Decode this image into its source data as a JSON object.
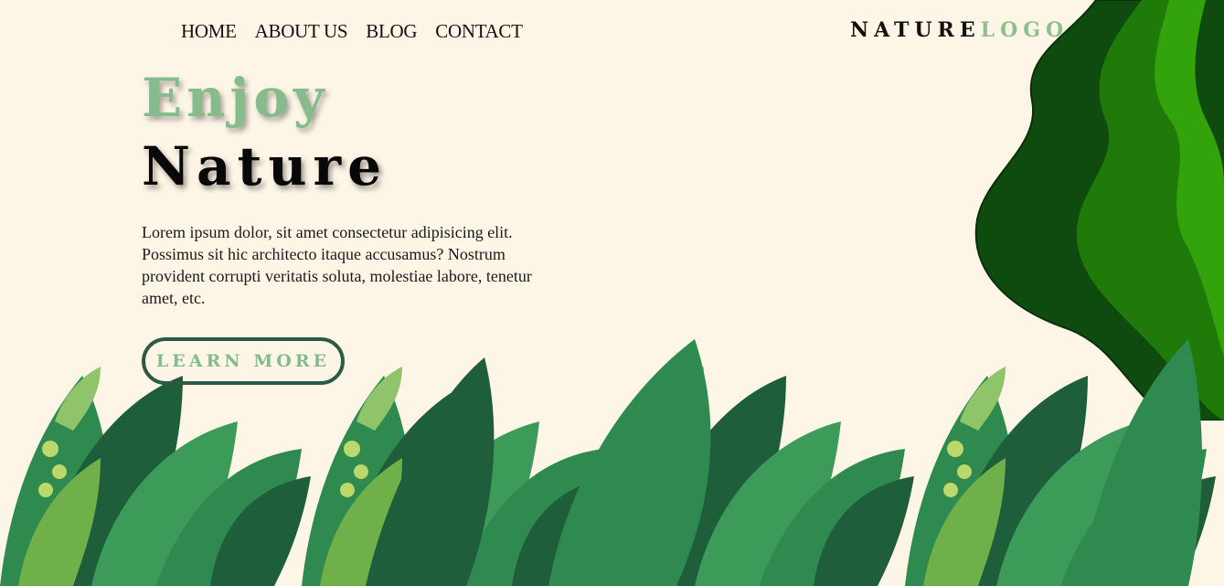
{
  "nav": {
    "items": [
      {
        "label": "HOME"
      },
      {
        "label": "ABOUT US"
      },
      {
        "label": "BLOG"
      },
      {
        "label": "CONTACT"
      }
    ]
  },
  "logo": {
    "part1": "NATURE",
    "part2": "LOGO"
  },
  "hero": {
    "line1": "Enjoy",
    "line2": "Nature",
    "description": "Lorem ipsum dolor, sit amet consectetur adipisicing elit. Possimus sit hic architecto itaque accusamus? Nostrum provident corrupti veritatis soluta, molestiae labore, tenetur amet, etc.",
    "button_label": "LEARN MORE"
  },
  "colors": {
    "background": "#fdf5e6",
    "accent_green": "#86bc8b",
    "dark_green": "#2d5a45",
    "leaf_dark": "#1f5e3a",
    "leaf_mid": "#2f8a4f",
    "leaf_light": "#6fb04a",
    "wave_dark": "#0f4a0f",
    "wave_mid": "#1f7a0a",
    "wave_bright": "#33a30c"
  }
}
